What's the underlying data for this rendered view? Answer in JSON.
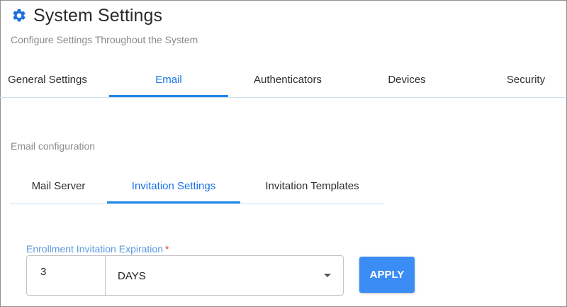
{
  "header": {
    "title": "System Settings",
    "subtitle": "Configure Settings Throughout the System",
    "accent_color": "#1e6fd9"
  },
  "main_tabs": [
    {
      "label": "General Settings",
      "active": false
    },
    {
      "label": "Email",
      "active": true
    },
    {
      "label": "Authenticators",
      "active": false
    },
    {
      "label": "Devices",
      "active": false
    },
    {
      "label": "Security",
      "active": false
    }
  ],
  "email": {
    "section_label": "Email configuration",
    "sub_tabs": [
      {
        "label": "Mail Server",
        "active": false
      },
      {
        "label": "Invitation Settings",
        "active": true
      },
      {
        "label": "Invitation Templates",
        "active": false
      }
    ]
  },
  "form": {
    "expiration_label": "Enrollment Invitation Expiration",
    "required_marker": "*",
    "expiration_value": "3",
    "unit_value": "DAYS",
    "apply_label": "APPLY"
  }
}
